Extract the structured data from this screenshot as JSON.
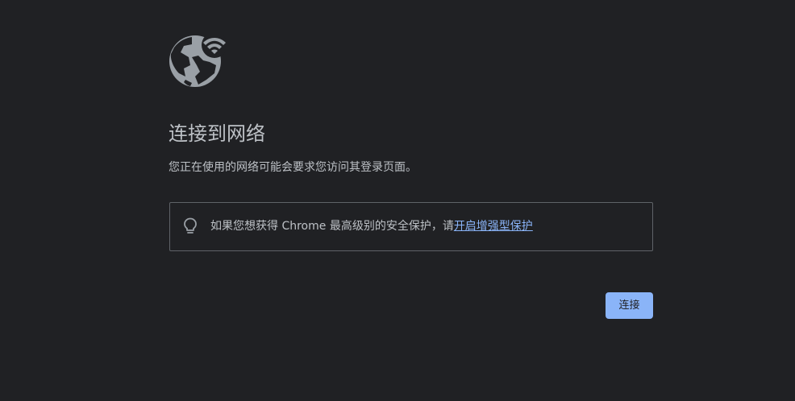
{
  "page": {
    "title": "连接到网络",
    "subtitle": "您正在使用的网络可能会要求您访问其登录页面。"
  },
  "info_box": {
    "text": "如果您想获得 Chrome 最高级别的安全保护，请",
    "link_label": "开启增强型保护",
    "icon": "lightbulb-icon"
  },
  "actions": {
    "connect_label": "连接"
  },
  "icons": {
    "hero": "globe-wifi-icon"
  },
  "colors": {
    "background": "#202124",
    "text": "#bdc1c6",
    "link": "#8ab4f8",
    "button": "#8ab4f8",
    "button_text": "#202124",
    "border": "#5f6368",
    "icon": "#9aa0a6"
  }
}
